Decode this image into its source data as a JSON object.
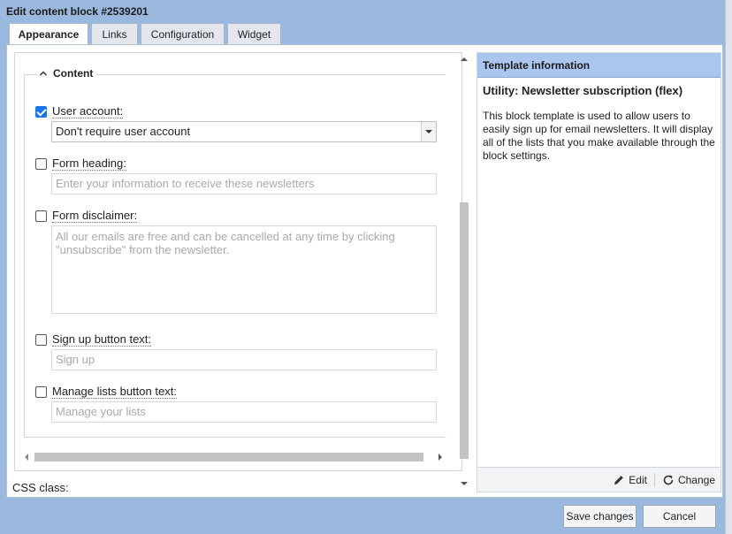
{
  "window": {
    "title": "Edit content block #2539201"
  },
  "tabs": [
    {
      "label": "Appearance"
    },
    {
      "label": "Links"
    },
    {
      "label": "Configuration"
    },
    {
      "label": "Widget"
    }
  ],
  "content_section": {
    "legend": "Content",
    "user_account": {
      "label": "User account:",
      "checked": true,
      "selected_value": "Don't require user account"
    },
    "form_heading": {
      "label": "Form heading:",
      "checked": false,
      "placeholder": "Enter your information to receive these newsletters"
    },
    "form_disclaimer": {
      "label": "Form disclaimer:",
      "checked": false,
      "placeholder": "All our emails are free and can be cancelled at any time by clicking \"unsubscribe\" from the newsletter."
    },
    "signup_button_text": {
      "label": "Sign up button text:",
      "checked": false,
      "placeholder": "Sign up"
    },
    "manage_lists_button_text": {
      "label": "Manage lists button text:",
      "checked": false,
      "placeholder": "Manage your lists"
    },
    "css_class_label": "CSS class:"
  },
  "template_info": {
    "header": "Template information",
    "title": "Utility: Newsletter subscription (flex)",
    "description": "This block template is used to allow users to easily sign up for email newsletters. It will display all of the lists that you make available through the block settings.",
    "edit_label": "Edit",
    "change_label": "Change"
  },
  "footer": {
    "save_label": "Save changes",
    "cancel_label": "Cancel"
  }
}
